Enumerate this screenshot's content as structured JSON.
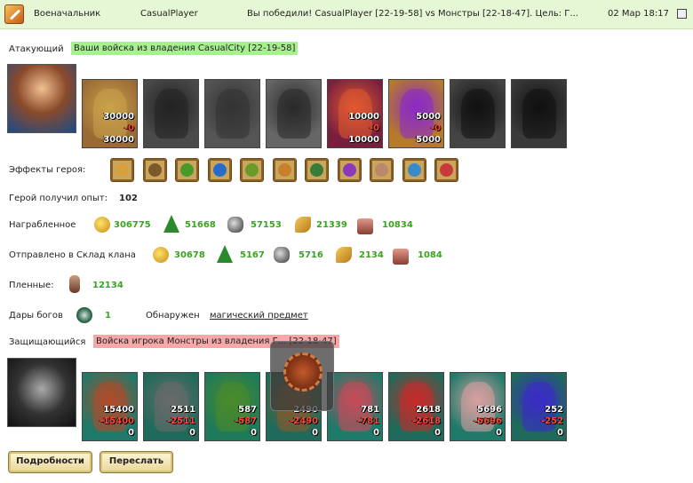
{
  "header": {
    "title": "Военачальник",
    "player": "CasualPlayer",
    "message": "Вы победили! CasualPlayer [22-19-58] vs Монстры [22-18-47]. Цель: Г...",
    "date": "02 Мар 18:17"
  },
  "attacker": {
    "label": "Атакующий",
    "tag": "Ваши войска из владения CasualCity [22-19-58]",
    "units": [
      {
        "c1": "30000",
        "c2": "-0",
        "c3": "30000",
        "bg": "#9a6a35",
        "fig": "#c9a24a"
      },
      {
        "c1": "",
        "c2": "",
        "c3": "",
        "bg": "#4a4a4a",
        "fig": "#222"
      },
      {
        "c1": "",
        "c2": "",
        "c3": "",
        "bg": "#555",
        "fig": "#333"
      },
      {
        "c1": "",
        "c2": "",
        "c3": "",
        "bg": "#666",
        "fig": "#2a2a2a"
      },
      {
        "c1": "10000",
        "c2": "-0",
        "c3": "10000",
        "bg": "#7a1e3e",
        "fig": "#e05a30"
      },
      {
        "c1": "5000",
        "c2": "-0",
        "c3": "5000",
        "bg": "#b67a2a",
        "fig": "#8a2ac8"
      },
      {
        "c1": "",
        "c2": "",
        "c3": "",
        "bg": "#444",
        "fig": "#111"
      },
      {
        "c1": "",
        "c2": "",
        "c3": "",
        "bg": "#3a3a3a",
        "fig": "#111"
      }
    ]
  },
  "effects": {
    "label": "Эффекты героя:",
    "icons": [
      "#d8a03a",
      "#7a5a2a",
      "#4a9a2a",
      "#2a6ac8",
      "#6a9a2a",
      "#c8802a",
      "#3a7a3a",
      "#8a3ab8",
      "#b88a6a",
      "#3a8ac8",
      "#c83a3a"
    ]
  },
  "experience": {
    "label": "Герой получил опыт:",
    "value": "102"
  },
  "reward": {
    "label": "Награбленное",
    "gold": "306775",
    "wood": "51668",
    "ore": "57153",
    "grain": "21339",
    "stone": "10834"
  },
  "clan": {
    "label": "Отправлено в Склад клана",
    "gold": "30678",
    "wood": "5167",
    "ore": "5716",
    "grain": "2134",
    "stone": "1084"
  },
  "prisoners": {
    "label": "Пленные:",
    "value": "12134"
  },
  "gifts": {
    "label": "Дары богов",
    "value": "1",
    "found": "Обнаружен",
    "item": "магический предмет"
  },
  "defender": {
    "label": "Защищающийся",
    "tag": "Войска игрока Монстры из владения Г... [22-18-47]",
    "units": [
      {
        "c1": "15400",
        "c2": "-15400",
        "c3": "0",
        "bg": "#1f7a6a",
        "fig": "#b04a2a"
      },
      {
        "c1": "2511",
        "c2": "-2511",
        "c3": "0",
        "bg": "#1f6a5a",
        "fig": "#6a6a6a"
      },
      {
        "c1": "587",
        "c2": "-587",
        "c3": "0",
        "bg": "#1f7a5a",
        "fig": "#4a8a2a"
      },
      {
        "c1": "2490",
        "c2": "-2490",
        "c3": "0",
        "bg": "#1f6a5a",
        "fig": "#8a5a2a"
      },
      {
        "c1": "781",
        "c2": "-781",
        "c3": "0",
        "bg": "#1f7a6a",
        "fig": "#c84a5a"
      },
      {
        "c1": "2618",
        "c2": "-2618",
        "c3": "0",
        "bg": "#1f6a5a",
        "fig": "#c82a2a"
      },
      {
        "c1": "5696",
        "c2": "-5696",
        "c3": "0",
        "bg": "#1f7a6a",
        "fig": "#d8a0a0"
      },
      {
        "c1": "252",
        "c2": "-252",
        "c3": "0",
        "bg": "#1f6a5a",
        "fig": "#3a2ac8"
      }
    ]
  },
  "buttons": {
    "details": "Подробности",
    "forward": "Переслать"
  }
}
